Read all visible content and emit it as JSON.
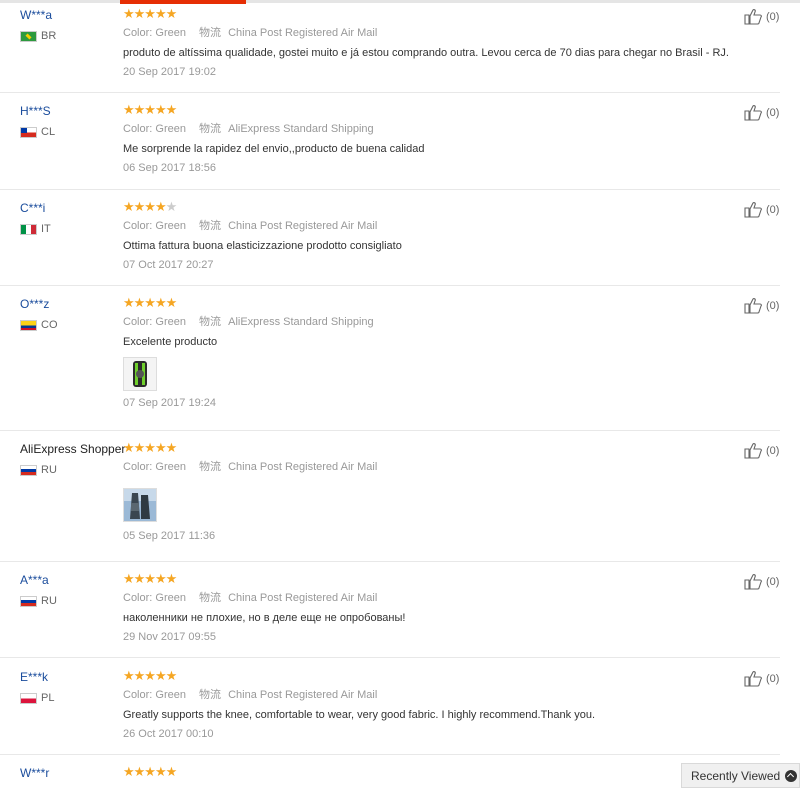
{
  "meta_labels": {
    "color": "Color:",
    "logistics": "物流"
  },
  "reviews": [
    {
      "user": "W***a",
      "country": "BR",
      "flag": "br",
      "stars": 5,
      "color": "Green",
      "shipping": "China Post Registered Air Mail",
      "text": "produto de altíssima qualidade, gostei muito e já estou comprando outra. Levou cerca de 70 dias para chegar no Brasil - RJ.",
      "date": "20 Sep 2017 19:02",
      "helpful": "(0)"
    },
    {
      "user": "H***S",
      "country": "CL",
      "flag": "cl",
      "stars": 5,
      "color": "Green",
      "shipping": "AliExpress Standard Shipping",
      "text": "Me sorprende la rapidez del envio,,producto de buena calidad",
      "date": "06 Sep 2017 18:56",
      "helpful": "(0)"
    },
    {
      "user": "C***i",
      "country": "IT",
      "flag": "it",
      "stars": 4,
      "color": "Green",
      "shipping": "China Post Registered Air Mail",
      "text": "Ottima fattura buona elasticizzazione prodotto consigliato",
      "date": "07 Oct 2017 20:27",
      "helpful": "(0)"
    },
    {
      "user": "O***z",
      "country": "CO",
      "flag": "co",
      "stars": 5,
      "color": "Green",
      "shipping": "AliExpress Standard Shipping",
      "text": "Excelente producto",
      "date": "07 Sep 2017 19:24",
      "helpful": "(0)"
    },
    {
      "user": "AliExpress Shopper",
      "country": "RU",
      "flag": "ru",
      "stars": 5,
      "color": "Green",
      "shipping": "China Post Registered Air Mail",
      "text": "",
      "date": "05 Sep 2017 11:36",
      "helpful": "(0)"
    },
    {
      "user": "A***a",
      "country": "RU",
      "flag": "ru",
      "stars": 5,
      "color": "Green",
      "shipping": "China Post Registered Air Mail",
      "text": "наколенники не плохие, но в деле еще не опробованы!",
      "date": "29 Nov 2017 09:55",
      "helpful": "(0)"
    },
    {
      "user": "E***k",
      "country": "PL",
      "flag": "pl",
      "stars": 5,
      "color": "Green",
      "shipping": "China Post Registered Air Mail",
      "text": "Greatly supports the knee, comfortable to wear, very good fabric. I highly recommend.Thank you.",
      "date": "26 Oct 2017 00:10",
      "helpful": "(0)"
    },
    {
      "user": "W***r",
      "country": "",
      "flag": "",
      "stars": 5,
      "color": "",
      "shipping": "",
      "text": "",
      "date": "",
      "helpful": ""
    }
  ],
  "recently_viewed": {
    "label": "Recently Viewed"
  },
  "icons": {
    "helpful": "thumbs-up-icon",
    "scroll_top": "chevron-up-icon"
  },
  "colors": {
    "accent": "#e62e04",
    "username": "#1a4c9c",
    "star": "#f5a623"
  }
}
